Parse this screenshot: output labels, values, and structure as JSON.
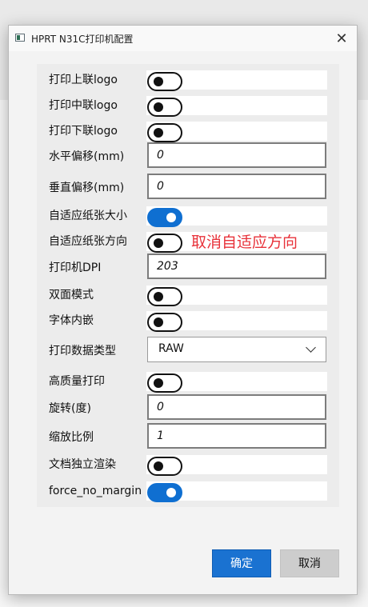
{
  "dialog": {
    "title": "HPRT N31C打印机配置",
    "annotation": "取消自适应方向",
    "ok_label": "确定",
    "cancel_label": "取消"
  },
  "rows": [
    {
      "label": "打印上联logo",
      "control": "toggle",
      "on": false
    },
    {
      "label": "打印中联logo",
      "control": "toggle",
      "on": false
    },
    {
      "label": "打印下联logo",
      "control": "toggle",
      "on": false
    },
    {
      "label": "水平偏移(mm)",
      "control": "input",
      "value": "0"
    },
    {
      "label": "垂直偏移(mm)",
      "control": "input",
      "value": "0"
    },
    {
      "label": "自适应纸张大小",
      "control": "toggle",
      "on": true
    },
    {
      "label": "自适应纸张方向",
      "control": "toggle",
      "on": false
    },
    {
      "label": "打印机DPI",
      "control": "input",
      "value": "203"
    },
    {
      "label": "双面模式",
      "control": "toggle",
      "on": false
    },
    {
      "label": "字体内嵌",
      "control": "toggle",
      "on": false
    },
    {
      "label": "打印数据类型",
      "control": "select",
      "value": "RAW"
    },
    {
      "label": "高质量打印",
      "control": "toggle",
      "on": false
    },
    {
      "label": "旋转(度)",
      "control": "input",
      "value": "0"
    },
    {
      "label": "缩放比例",
      "control": "input",
      "value": "1"
    },
    {
      "label": "文档独立渲染",
      "control": "toggle",
      "on": false
    },
    {
      "label": "force_no_margin",
      "control": "toggle",
      "on": true
    }
  ],
  "colors": {
    "accent": "#0f6fd1",
    "annotation": "#e8323a",
    "dialog_bg": "#f3f3f3"
  },
  "icons": {
    "app": "printer-app-icon",
    "close": "close-icon",
    "dropdown": "chevron-down-icon"
  }
}
